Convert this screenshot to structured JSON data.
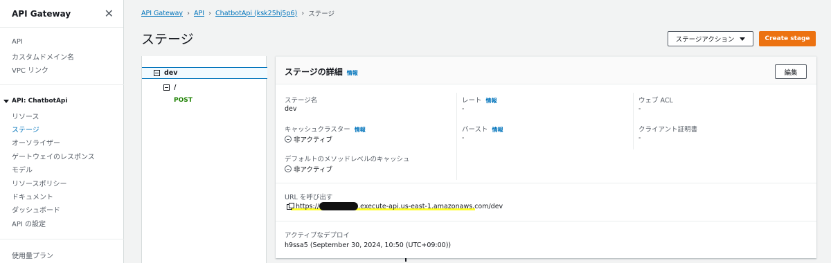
{
  "sidebar": {
    "title": "API Gateway",
    "top_items": [
      "API",
      "カスタムドメイン名",
      "VPC リンク"
    ],
    "group_title": "API: ChatbotApi",
    "group_items": [
      {
        "label": "リソース",
        "active": false
      },
      {
        "label": "ステージ",
        "active": true
      },
      {
        "label": "オーソライザー",
        "active": false
      },
      {
        "label": "ゲートウェイのレスポンス",
        "active": false
      },
      {
        "label": "モデル",
        "active": false
      },
      {
        "label": "リソースポリシー",
        "active": false
      },
      {
        "label": "ドキュメント",
        "active": false
      },
      {
        "label": "ダッシュボード",
        "active": false
      },
      {
        "label": "API の設定",
        "active": false
      }
    ],
    "bottom_item": "使用量プラン"
  },
  "breadcrumb": [
    "API Gateway",
    "API",
    "ChatbotApi (ksk25hj5p6)",
    "ステージ"
  ],
  "page_title": "ステージ",
  "actions": {
    "stage_actions_label": "ステージアクション",
    "create_stage_label": "Create stage"
  },
  "tree": {
    "stage": "dev",
    "resource": "/",
    "method": "POST"
  },
  "details": {
    "title": "ステージの詳細",
    "info_label": "情報",
    "edit_label": "編集",
    "fields": {
      "stage_name": {
        "label": "ステージ名",
        "value": "dev"
      },
      "rate": {
        "label": "レート",
        "value": "-"
      },
      "web_acl": {
        "label": "ウェブ ACL",
        "value": "-"
      },
      "cache_cluster": {
        "label": "キャッシュクラスター",
        "value": "非アクティブ"
      },
      "burst": {
        "label": "バースト",
        "value": "-"
      },
      "client_cert": {
        "label": "クライアント証明書",
        "value": "-"
      },
      "method_cache": {
        "label": "デフォルトのメソッドレベルのキャッシュ",
        "value": "非アクティブ"
      }
    },
    "invoke_url": {
      "label": "URL を呼び出す",
      "prefix": "https://",
      "suffix": ".execute-api.us-east-1.amazonaws.com/dev"
    },
    "deployment": {
      "label": "アクティブなデプロイ",
      "value": "h9ssa5 (September 30, 2024, 10:50 (UTC+09:00))"
    }
  },
  "colors": {
    "link": "#0073bb",
    "primary_button": "#ec7211",
    "method_green": "#1d8102",
    "highlight": "#ffff2a"
  }
}
